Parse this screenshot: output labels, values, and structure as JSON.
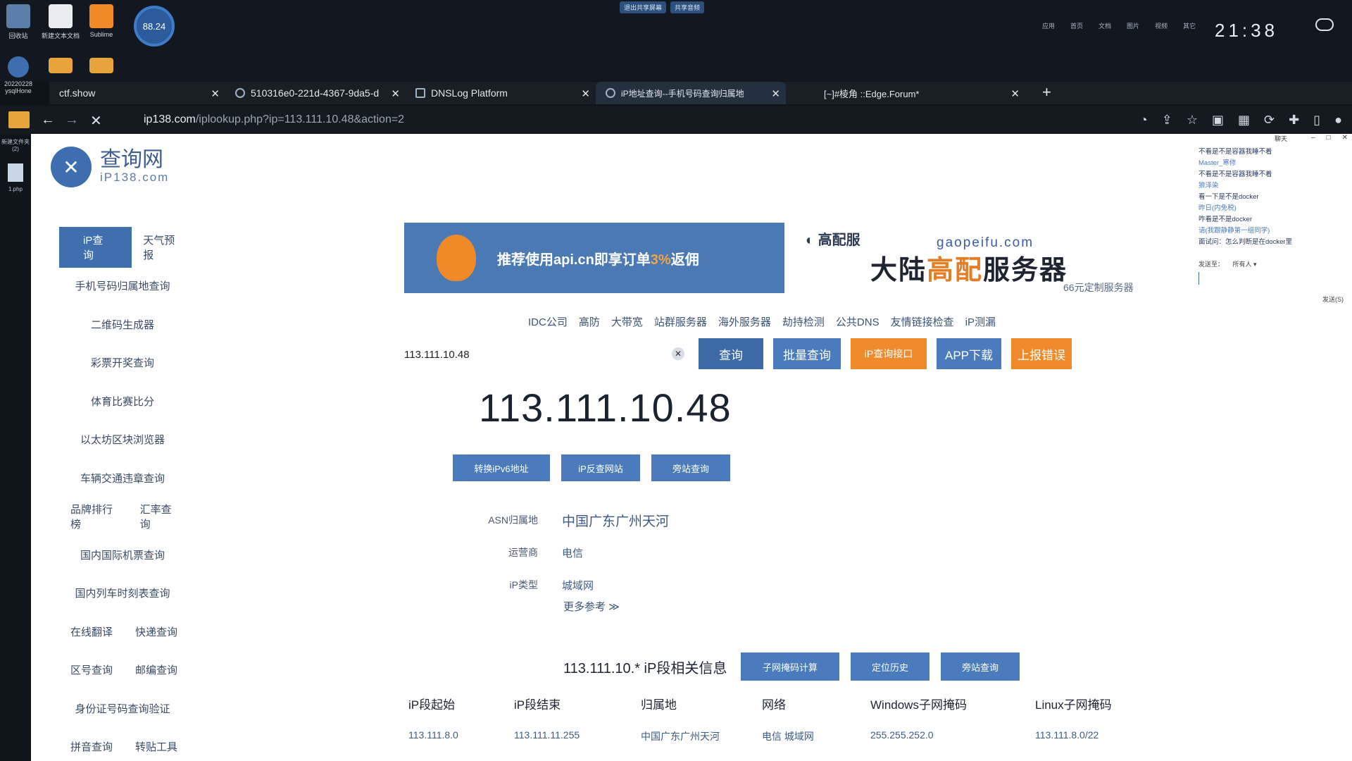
{
  "desktop": {
    "icons": [
      {
        "label": "回收站"
      },
      {
        "label": "新建文本文档"
      },
      {
        "label": "Sublime"
      },
      {
        "label": "20220228 ysqlHone"
      },
      {
        "label": "folder"
      },
      {
        "label": "folder"
      }
    ],
    "gauge": "88.24",
    "center_buttons": [
      "退出共享屏幕",
      "共享音频"
    ],
    "clock": "21:38",
    "right_menu": [
      "应用",
      "首页",
      "文档",
      "图片",
      "视频",
      "其它"
    ],
    "left_files": [
      "新建文件夹(2)",
      "1.php"
    ]
  },
  "browser": {
    "tabs": [
      {
        "label": "ctf.show"
      },
      {
        "label": "510316e0-221d-4367-9da5-d"
      },
      {
        "label": "DNSLog Platform"
      },
      {
        "label": "iP地址查询--手机号码查询归属地"
      },
      {
        "label": "[~]#棱角 ::Edge.Forum*"
      }
    ],
    "url_domain": "ip138.com",
    "url_path": "/iplookup.php?ip=113.111.10.48&action=2"
  },
  "site": {
    "logo_title": "查询网",
    "logo_sub": "iP138.com",
    "sidenav": [
      [
        "iP查询",
        "天气预报"
      ],
      [
        "手机号码归属地查询"
      ],
      [
        "二维码生成器"
      ],
      [
        "彩票开奖查询"
      ],
      [
        "体育比赛比分"
      ],
      [
        "以太坊区块浏览器"
      ],
      [
        "车辆交通违章查询"
      ],
      [
        "品牌排行榜",
        "汇率查询"
      ],
      [
        "国内国际机票查询"
      ],
      [
        "国内列车时刻表查询"
      ],
      [
        "在线翻译",
        "快递查询"
      ],
      [
        "区号查询",
        "邮编查询"
      ],
      [
        "身份证号码查询验证"
      ],
      [
        "拼音查询",
        "转贴工具"
      ]
    ],
    "banner1": {
      "text_a": "推荐使用api.cn即享订单",
      "text_pct": "3%",
      "text_b": "返佣"
    },
    "banner2": {
      "brand": "高配服",
      "domain": "gaopeifu.com",
      "big_a": "大陆",
      "big_hl": "高配",
      "big_b": "服务器",
      "sub": "66元定制服务器"
    },
    "toplinks": [
      "IDC公司",
      "高防",
      "大带宽",
      "站群服务器",
      "海外服务器",
      "劫持检测",
      "公共DNS",
      "友情链接检查",
      "iP测漏"
    ],
    "search": {
      "value": "113.111.10.48"
    },
    "buttons": {
      "query": "查询",
      "batch": "批量查询",
      "api": "iP查询接口",
      "app": "APP下载",
      "report": "上报错误"
    },
    "result": {
      "ip": "113.111.10.48",
      "sub_buttons": [
        "转换iPv6地址",
        "iP反查网站",
        "旁站查询"
      ],
      "rows": [
        {
          "k": "ASN归属地",
          "v": "中国广东广州天河"
        },
        {
          "k": "运营商",
          "v": "电信"
        },
        {
          "k": "iP类型",
          "v": "城域网"
        }
      ],
      "more": "更多参考 ≫"
    },
    "segment": {
      "title": "113.111.10.* iP段相关信息",
      "buttons": [
        "子网掩码计算",
        "定位历史",
        "旁站查询"
      ],
      "headers": [
        "iP段起始",
        "iP段结束",
        "归属地",
        "网络",
        "Windows子网掩码",
        "Linux子网掩码"
      ],
      "row": [
        "113.111.8.0",
        "113.111.11.255",
        "中国广东广州天河",
        "电信 城域网",
        "255.255.252.0",
        "113.111.8.0/22"
      ]
    }
  },
  "chat": {
    "title": "聊天",
    "messages": [
      {
        "t": "不看是不是容器我睡不着",
        "meta": false
      },
      {
        "t": "Master_寒修",
        "meta": true
      },
      {
        "t": "不看是不是容器我睡不着",
        "meta": false
      },
      {
        "t": "狼泽染",
        "meta": true
      },
      {
        "t": "看一下是不是docker",
        "meta": false
      },
      {
        "t": "昨日(内免税)",
        "meta": true
      },
      {
        "t": "咋看是不是docker",
        "meta": false
      },
      {
        "t": "请(我跟静静第一组同学)",
        "meta": true
      },
      {
        "t": "面试问：怎么判断是在docker里",
        "meta": false
      }
    ],
    "send_to_label": "发送至：",
    "send_to_value": "所有人",
    "send_btn": "发送(S)"
  }
}
